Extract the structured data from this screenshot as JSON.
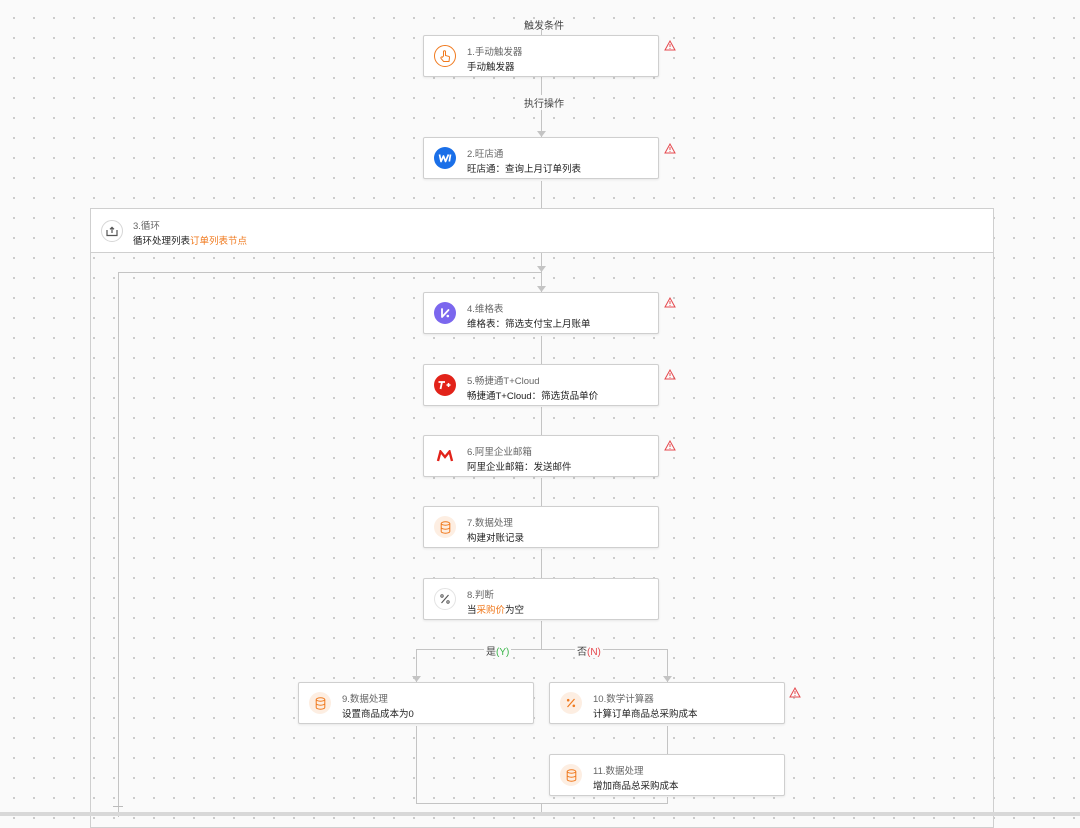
{
  "labels": {
    "trigger_condition": "触发条件",
    "execute_action": "执行操作",
    "branch_yes_prefix": "是",
    "branch_yes_suffix": "(Y)",
    "branch_no_prefix": "否",
    "branch_no_suffix": "(N)"
  },
  "nodes": {
    "n1": {
      "title": "1.手动触发器",
      "desc": "手动触发器",
      "icon": "hand-pointer-icon"
    },
    "n2": {
      "title": "2.旺店通",
      "desc": "旺店通：查询上月订单列表",
      "icon": "wangdiantong-logo-icon"
    },
    "n3": {
      "title": "3.循环",
      "desc_prefix": "循环处理列表",
      "desc_highlight": "订单列表节点",
      "icon": "loop-icon"
    },
    "n4": {
      "title": "4.维格表",
      "desc": "维格表：筛选支付宝上月账单",
      "icon": "vika-logo-icon"
    },
    "n5": {
      "title": "5.畅捷通T+Cloud",
      "desc": "畅捷通T+Cloud：筛选货品单价",
      "icon": "tplus-logo-icon"
    },
    "n6": {
      "title": "6.阿里企业邮箱",
      "desc": "阿里企业邮箱：发送邮件",
      "icon": "mail-logo-icon"
    },
    "n7": {
      "title": "7.数据处理",
      "desc": "构建对账记录",
      "icon": "database-icon"
    },
    "n8": {
      "title": "8.判断",
      "desc_prefix": "当",
      "desc_highlight": "采购价",
      "desc_suffix": "为空",
      "icon": "condition-icon"
    },
    "n9": {
      "title": "9.数据处理",
      "desc": "设置商品成本为0",
      "icon": "database-icon"
    },
    "n10": {
      "title": "10.数学计算器",
      "desc": "计算订单商品总采购成本",
      "icon": "percent-calculator-icon"
    },
    "n11": {
      "title": "11.数据处理",
      "desc": "增加商品总采购成本",
      "icon": "database-icon"
    }
  },
  "colors": {
    "accent_orange": "#f07a1f",
    "warning_red": "#e5484d",
    "yes_green": "#3bb54a",
    "no_red": "#e5484d"
  }
}
